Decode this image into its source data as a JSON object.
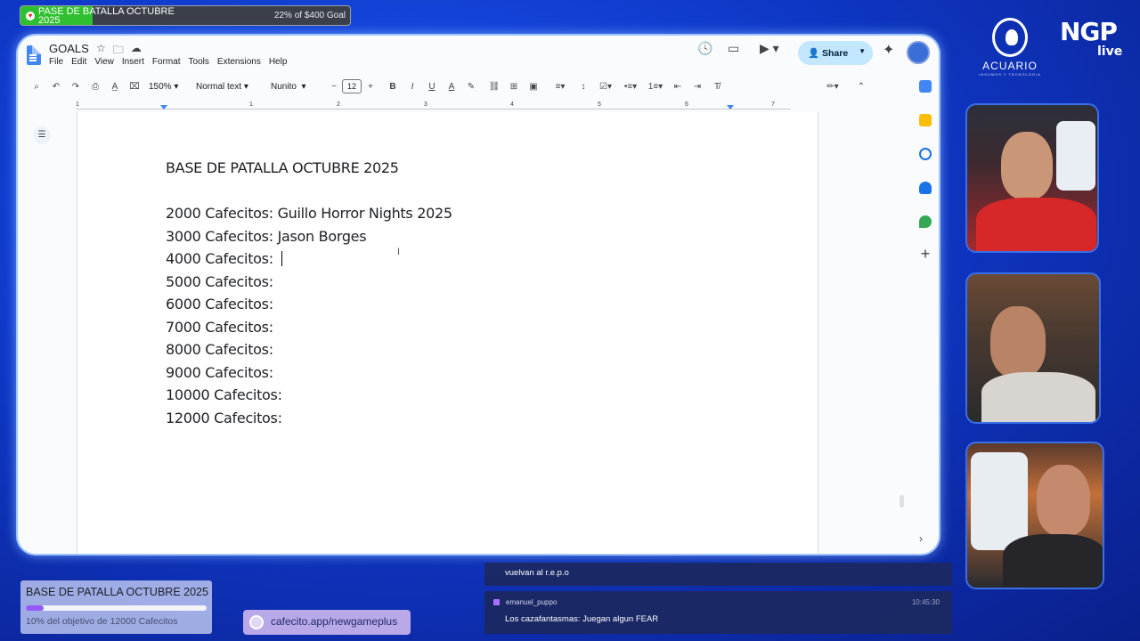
{
  "goal_top": {
    "title": "PASE DE BATALLA OCTUBRE 2025",
    "status": "22% of $400 Goal",
    "progress": 0.22
  },
  "app": {
    "doc_title": "GOALS",
    "menu": [
      "File",
      "Edit",
      "View",
      "Insert",
      "Format",
      "Tools",
      "Extensions",
      "Help"
    ],
    "share_label": "Share",
    "toolbar": {
      "zoom": "150%",
      "style": "Normal text",
      "font": "Nunito",
      "font_size": "12"
    },
    "ruler_numbers": [
      "1",
      "1",
      "2",
      "3",
      "4",
      "5",
      "6",
      "7"
    ]
  },
  "document": {
    "lines": [
      "BASE DE PATALLA OCTUBRE 2025",
      "",
      "2000 Cafecitos: Guillo Horror Nights 2025",
      "3000 Cafecitos: Jason Borges",
      "4000 Cafecitos: ",
      "5000 Cafecitos:",
      "6000 Cafecitos:",
      "7000 Cafecitos:",
      "8000 Cafecitos:",
      "9000 Cafecitos:",
      "10000 Cafecitos:",
      "12000 Cafecitos:"
    ]
  },
  "branding": {
    "acuario": "ACUARIO",
    "acuario_sub": "INSUMOS Y TECNOLOGIA",
    "ngp": "NGP",
    "ngp_live": "live"
  },
  "goal_bottom": {
    "title": "BASE DE PATALLA OCTUBRE 2025",
    "status": "10% del objetivo de 12000 Cafecitos",
    "progress": 0.1
  },
  "cafecito": {
    "label": "cafecito.app/newgameplus"
  },
  "chat": [
    {
      "user": "",
      "text": "vuelvan al r.e.p.o",
      "time": ""
    },
    {
      "user": "emanuel_puppo",
      "text": "Los cazafantasmas: Juegan algun FEAR",
      "time": "10:45:30"
    }
  ],
  "colors": {
    "accent": "#0b57d0",
    "share_bg": "#c2e7ff",
    "goal_fill": "#2fc02f",
    "goal_bottom_fill": "#9b5cff"
  }
}
